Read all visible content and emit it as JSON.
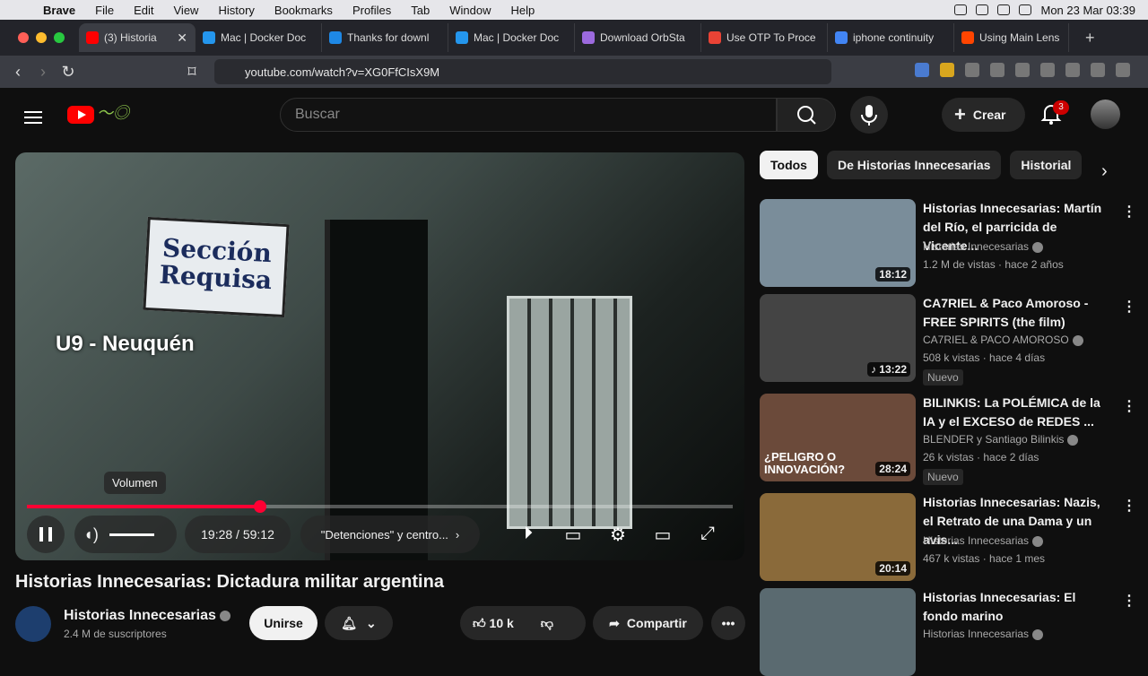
{
  "menubar": {
    "app": "Brave",
    "items": [
      "File",
      "Edit",
      "View",
      "History",
      "Bookmarks",
      "Profiles",
      "Tab",
      "Window",
      "Help"
    ],
    "clock": "Mon 23 Mar  03:39"
  },
  "tabs": [
    {
      "label": "(3) Historia",
      "color": "#ff0000"
    },
    {
      "label": "Mac | Docker Doc",
      "color": "#2496ed"
    },
    {
      "label": "Thanks for downl",
      "color": "#1e88e5"
    },
    {
      "label": "Mac | Docker Doc",
      "color": "#2496ed"
    },
    {
      "label": "Download OrbSta",
      "color": "#9c6ade"
    },
    {
      "label": "Use OTP To Proce",
      "color": "#ea4335"
    },
    {
      "label": "iphone continuity",
      "color": "#4285f4"
    },
    {
      "label": "Using Main Lens",
      "color": "#ff4500"
    }
  ],
  "url": "youtube.com/watch?v=XG0FfCIsX9M",
  "shield_badge": "1",
  "yt": {
    "search_placeholder": "Buscar",
    "crear": "Crear",
    "notif_count": "3"
  },
  "video": {
    "sign_line1": "Sección",
    "sign_line2": "Requisa",
    "overlay": "U9 - Neuquén",
    "tooltip": "Volumen",
    "progress": 0.33,
    "time": "19:28 / 59:12",
    "chapter": "\"Detenciones\" y centro...",
    "title": "Historias Innecesarias: Dictadura militar argentina"
  },
  "channel": {
    "name": "Historias Innecesarias",
    "subs": "2.4 M de suscriptores",
    "join": "Unirse",
    "likes": "10 k",
    "share": "Compartir"
  },
  "chips": [
    "Todos",
    "De Historias Innecesarias",
    "Historial"
  ],
  "recs": [
    {
      "title": "Historias Innecesarias: Martín del Río, el parricida de Vicente...",
      "channel": "Historias Innecesarias",
      "meta": "1.2 M de vistas · hace 2 años",
      "dur": "18:12",
      "thumb": "#7a8d9a",
      "nuevo": ""
    },
    {
      "title": "CA7RIEL & Paco Amoroso - FREE SPIRITS (the film)",
      "channel": "CA7RIEL & PACO AMOROSO",
      "meta": "508 k vistas · hace 4 días",
      "dur": "♪ 13:22",
      "thumb": "#444",
      "nuevo": "Nuevo"
    },
    {
      "title": "BILINKIS: La POLÉMICA de la IA y el EXCESO de REDES ...",
      "channel": "BLENDER y Santiago Bilinkis",
      "meta": "26 k vistas · hace 2 días",
      "dur": "28:24",
      "thumb": "#6b4a3a",
      "nuevo": "Nuevo",
      "overlay": "¿PELIGRO O INNOVACIÓN?"
    },
    {
      "title": "Historias Innecesarias: Nazis, el Retrato de una Dama y un avis...",
      "channel": "Historias Innecesarias",
      "meta": "467 k vistas · hace 1 mes",
      "dur": "20:14",
      "thumb": "#8a6a3a",
      "nuevo": ""
    },
    {
      "title": "Historias Innecesarias: El fondo marino",
      "channel": "Historias Innecesarias",
      "meta": "",
      "dur": "",
      "thumb": "#5a6a70",
      "nuevo": ""
    }
  ]
}
